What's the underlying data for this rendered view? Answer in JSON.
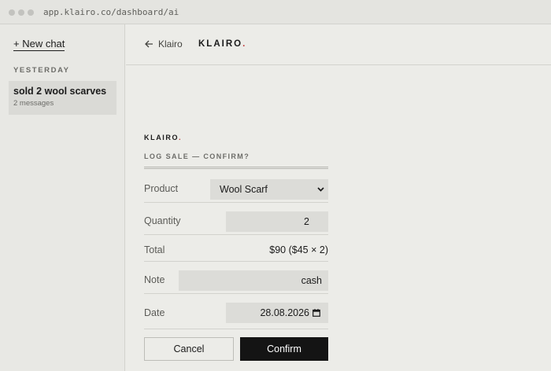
{
  "browser": {
    "url": "app.klairo.co/dashboard/ai"
  },
  "sidebar": {
    "new_chat": "+ New chat",
    "section": "YESTERDAY",
    "chats": [
      {
        "title": "sold 2 wool scarves",
        "subtitle": "2 messages"
      }
    ]
  },
  "topbar": {
    "back": "Klairo",
    "brand": "KLAIRO",
    "brand_dot": "."
  },
  "card": {
    "brand": "KLAIRO",
    "brand_dot": ".",
    "title": "LOG SALE — CONFIRM?",
    "fields": {
      "product": {
        "label": "Product",
        "value": "Wool Scarf"
      },
      "quantity": {
        "label": "Quantity",
        "value": "2"
      },
      "total": {
        "label": "Total",
        "value": "$90 ($45 × 2)"
      },
      "note": {
        "label": "Note",
        "value": "cash"
      },
      "date": {
        "label": "Date",
        "value": "28.08.2026"
      }
    },
    "cancel": "Cancel",
    "confirm": "Confirm"
  },
  "colors": {
    "accent": "#c04040",
    "primary_button": "#141414",
    "background": "#ecece8"
  }
}
